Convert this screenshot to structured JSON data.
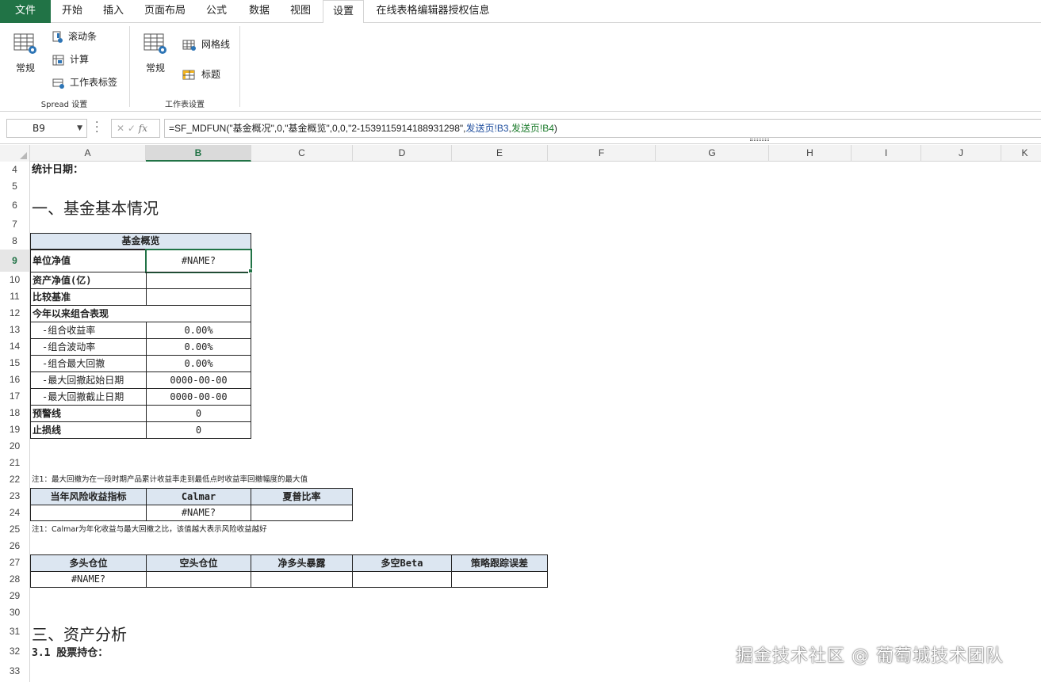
{
  "tabs": [
    "文件",
    "开始",
    "插入",
    "页面布局",
    "公式",
    "数据",
    "视图",
    "设置",
    "在线表格编辑器授权信息"
  ],
  "active_tab": "设置",
  "ribbon": {
    "group1": {
      "big": "常规",
      "small": [
        "滚动条",
        "计算",
        "工作表标签"
      ],
      "title": "Spread 设置"
    },
    "group2": {
      "big": "常规",
      "small": [
        "网格线",
        "标题"
      ],
      "title": "工作表设置"
    }
  },
  "formula_bar": {
    "name_box": "B9",
    "fx": "fx",
    "formula_main": "=SF_MDFUN(\"基金概况\",0,\"基金概览\",0,0,\"2-1539115914188931298\",",
    "ref1": "发送页!B3",
    "comma": ",",
    "ref2": "发送页!B4",
    "close": ")"
  },
  "columns": [
    "A",
    "B",
    "C",
    "D",
    "E",
    "F",
    "G",
    "H",
    "I",
    "J",
    "K"
  ],
  "rows": [
    "4",
    "5",
    "6",
    "7",
    "8",
    "9",
    "10",
    "11",
    "12",
    "13",
    "14",
    "15",
    "16",
    "17",
    "18",
    "19",
    "20",
    "21",
    "22",
    "23",
    "24",
    "25",
    "26",
    "27",
    "28",
    "29",
    "30",
    "31",
    "32",
    "33"
  ],
  "sheet": {
    "stat_date": "统计日期：",
    "section1": "一、基金基本情况",
    "overview_header": "基金概览",
    "overview": [
      {
        "label": "单位净值",
        "value": "#NAME?"
      },
      {
        "label": "资产净值(亿)",
        "value": ""
      },
      {
        "label": "比较基准",
        "value": ""
      },
      {
        "label": "今年以来组合表现",
        "value": ""
      },
      {
        "label": "-组合收益率",
        "value": "0.00%"
      },
      {
        "label": "-组合波动率",
        "value": "0.00%"
      },
      {
        "label": "-组合最大回撤",
        "value": "0.00%"
      },
      {
        "label": "-最大回撤起始日期",
        "value": "0000-00-00"
      },
      {
        "label": "-最大回撤截止日期",
        "value": "0000-00-00"
      },
      {
        "label": "预警线",
        "value": "0"
      },
      {
        "label": "止损线",
        "value": "0"
      }
    ],
    "note1": "注1：最大回撤为在一段时期产品累计收益率走到最低点时收益率回撤幅度的最大值",
    "risk_headers": [
      "当年风险收益指标",
      "Calmar",
      "夏普比率"
    ],
    "risk_values": [
      "",
      "#NAME?",
      ""
    ],
    "note2": "注1：Calmar为年化收益与最大回撤之比，该值越大表示风险收益越好",
    "pos_headers": [
      "多头仓位",
      "空头仓位",
      "净多头暴露",
      "多空Beta",
      "策略跟踪误差"
    ],
    "pos_values": [
      "#NAME?",
      "",
      "",
      "",
      ""
    ],
    "section3": "三、资产分析",
    "section31": "3.1  股票持仓："
  },
  "watermark": "掘金技术社区 @ 葡萄城技术团队",
  "colors": {
    "accent": "#217346",
    "header_fill": "#dce6f1"
  }
}
